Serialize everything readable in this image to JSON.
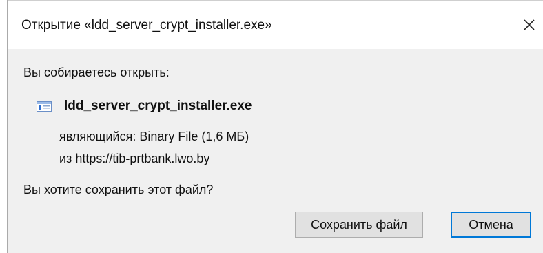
{
  "dialog": {
    "title": "Открытие «ldd_server_crypt_installer.exe»",
    "close_icon": "close-icon",
    "prompt_open": "Вы собираетесь открыть:",
    "file": {
      "icon": "executable-file-icon",
      "name": "ldd_server_crypt_installer.exe",
      "type_label": "являющийся:",
      "type_value": "Binary File (1,6 МБ)",
      "from_label": "из",
      "from_value": "https://tib-prtbank.lwo.by"
    },
    "prompt_save": "Вы хотите сохранить этот файл?",
    "buttons": {
      "save": "Сохранить файл",
      "cancel": "Отмена"
    }
  },
  "colors": {
    "dialog_background": "#f0f0f0",
    "titlebar_background": "#ffffff",
    "button_background": "#e1e1e1",
    "focus_border": "#0078d7",
    "file_icon_accent": "#2f6fd0"
  }
}
